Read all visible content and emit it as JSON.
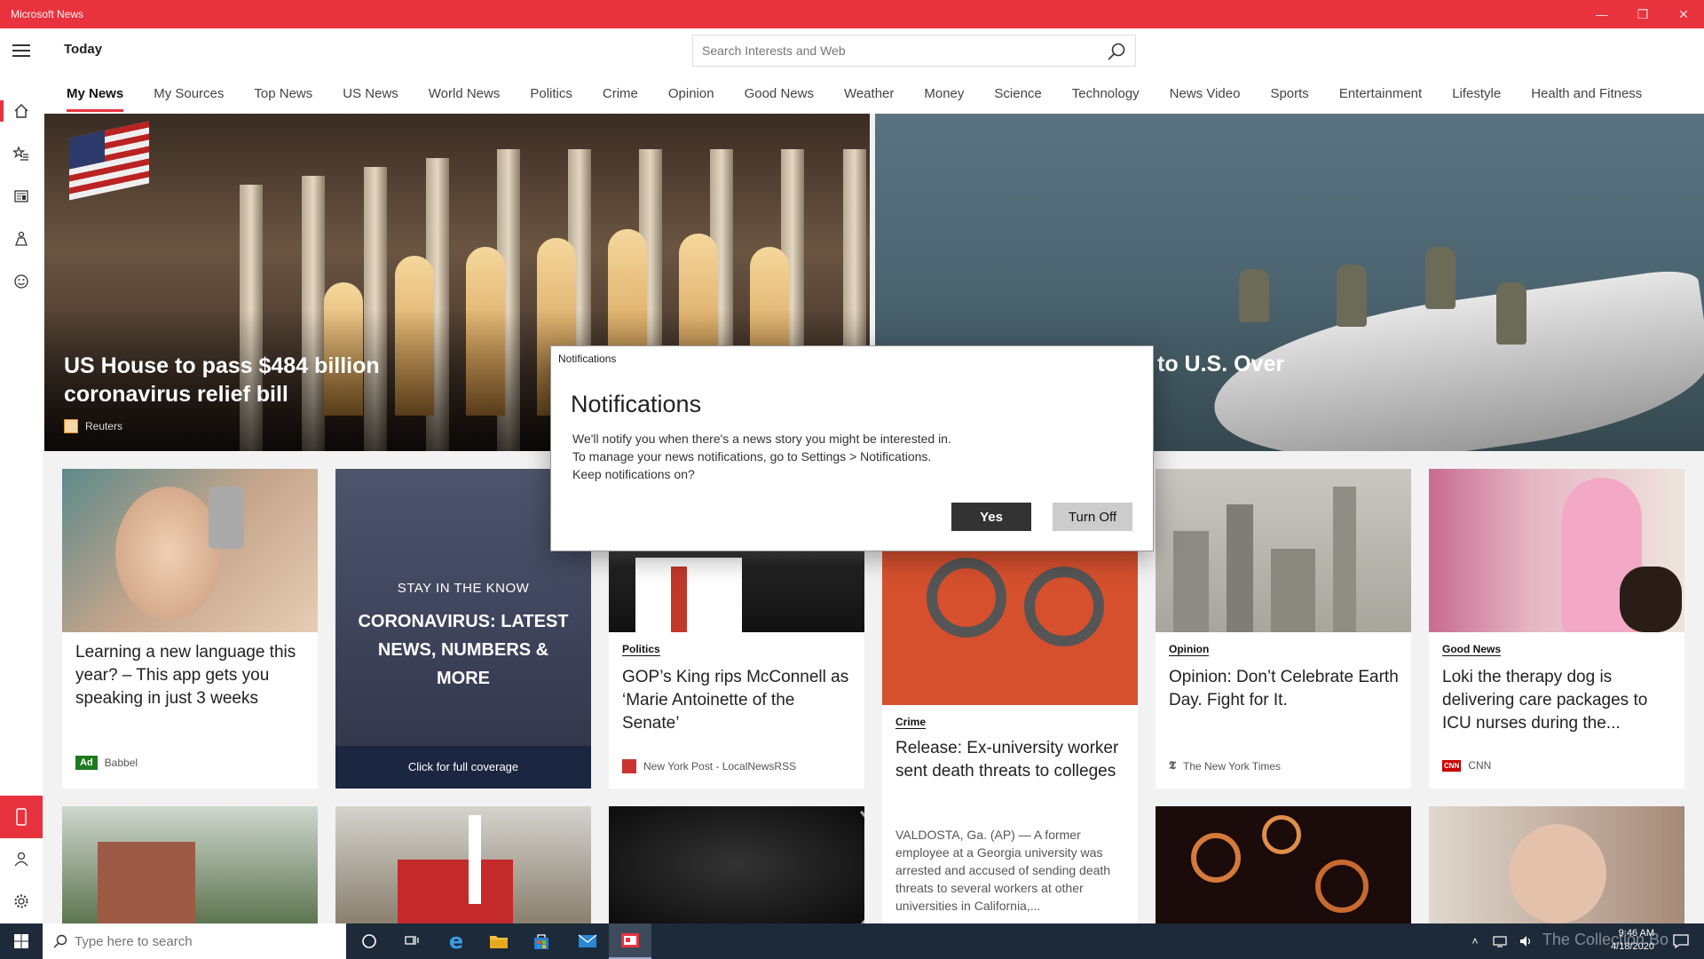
{
  "window": {
    "title": "Microsoft News",
    "minimize": "—",
    "restore": "❐",
    "close": "✕"
  },
  "header": {
    "page_title": "Today",
    "search_placeholder": "Search Interests and Web"
  },
  "nav_tabs": [
    {
      "label": "My News",
      "active": true
    },
    {
      "label": "My Sources"
    },
    {
      "label": "Top News"
    },
    {
      "label": "US News"
    },
    {
      "label": "World News"
    },
    {
      "label": "Politics"
    },
    {
      "label": "Crime"
    },
    {
      "label": "Opinion"
    },
    {
      "label": "Good News"
    },
    {
      "label": "Weather"
    },
    {
      "label": "Money"
    },
    {
      "label": "Science"
    },
    {
      "label": "Technology"
    },
    {
      "label": "News Video"
    },
    {
      "label": "Sports"
    },
    {
      "label": "Entertainment"
    },
    {
      "label": "Lifestyle"
    },
    {
      "label": "Health and Fitness"
    }
  ],
  "rail_icons": [
    "home-icon",
    "favorites-icon",
    "newspaper-icon",
    "interests-icon",
    "smiley-icon",
    "phone-icon",
    "profile-icon",
    "settings-icon"
  ],
  "hero": [
    {
      "title": "US House to pass $484 billion coronavirus relief bill",
      "source": "Reuters"
    },
    {
      "title": "to U.S. Over"
    }
  ],
  "cards": [
    {
      "title": "Learning a new language this year? – This app gets you speaking in just 3 weeks",
      "badge": "Ad",
      "source": "Babbel"
    },
    {
      "kicker": "STAY IN THE KNOW",
      "title": "CORONAVIRUS: LATEST NEWS, NUMBERS & MORE",
      "footer": "Click for full coverage"
    },
    {
      "category": "Politics",
      "title": "GOP’s King rips McConnell as ‘Marie Antoinette of the Senate’",
      "source": "New York Post - LocalNewsRSS"
    },
    {
      "category": "Crime",
      "title": "Release: Ex-university worker sent death threats to colleges",
      "excerpt": "VALDOSTA, Ga. (AP) — A former employee at a Georgia university was arrested and accused of sending death threats to several workers at other universities in California,..."
    },
    {
      "category": "Opinion",
      "title": "Opinion: Don’t Celebrate Earth Day. Fight for It.",
      "source": "The New York Times"
    },
    {
      "category": "Good News",
      "title": "Loki the therapy dog is delivering care packages to ICU nurses during the...",
      "source": "CNN"
    }
  ],
  "dialog": {
    "caption": "Notifications",
    "title": "Notifications",
    "line1": "We'll notify you when there's a news story you might be interested in.",
    "line2": "To manage your news notifications, go to Settings > Notifications.",
    "line3": "Keep notifications on?",
    "yes": "Yes",
    "turn_off": "Turn Off"
  },
  "taskbar": {
    "search_placeholder": "Type here to search",
    "time": "9:46 AM",
    "date": "4/18/2020",
    "watermark": "The Collection Bo"
  },
  "colors": {
    "accent": "#e8333f",
    "taskbar": "#1c2a3a",
    "ad_green": "#1f7a1f"
  }
}
